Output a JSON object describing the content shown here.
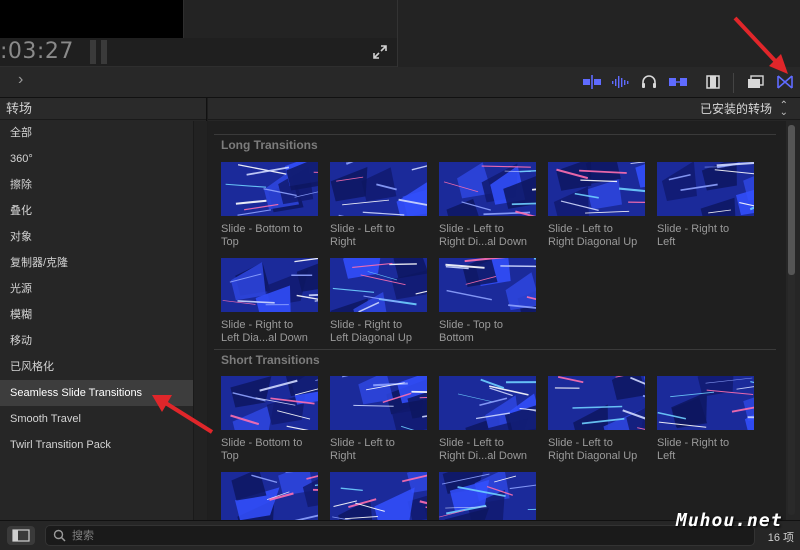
{
  "timecode": ":03:27",
  "toolbar": {
    "icons": [
      "clip-blade-icon",
      "audio-waveform-icon",
      "headphones-icon",
      "snapping-icon",
      "video-clips-icon",
      "photos-icon",
      "transitions-browser-icon"
    ],
    "accent": "#5f6bff"
  },
  "sidebar": {
    "title": "转场",
    "items": [
      {
        "label": "全部"
      },
      {
        "label": "360°"
      },
      {
        "label": "擦除"
      },
      {
        "label": "叠化"
      },
      {
        "label": "对象"
      },
      {
        "label": "复制器/克隆"
      },
      {
        "label": "光源"
      },
      {
        "label": "模糊"
      },
      {
        "label": "移动"
      },
      {
        "label": "已风格化"
      },
      {
        "label": "Seamless Slide Transitions"
      },
      {
        "label": "Smooth Travel"
      },
      {
        "label": "Twirl Transition Pack"
      }
    ],
    "selected_index": 10
  },
  "browser": {
    "filter_label": "已安装的转场",
    "sections": [
      {
        "title": "Long Transitions",
        "items": [
          {
            "line1": "Slide - Bottom to",
            "line2": "Top"
          },
          {
            "line1": "Slide - Left to",
            "line2": "Right"
          },
          {
            "line1": "Slide - Left to",
            "line2": "Right Di...al Down"
          },
          {
            "line1": "Slide - Left to",
            "line2": "Right Diagonal Up"
          },
          {
            "line1": "Slide - Right to",
            "line2": "Left"
          },
          {
            "line1": "Slide - Right to",
            "line2": "Left Dia...al Down"
          },
          {
            "line1": "Slide - Right to",
            "line2": "Left Diagonal Up"
          },
          {
            "line1": "Slide - Top to",
            "line2": "Bottom"
          }
        ]
      },
      {
        "title": "Short Transitions",
        "items": [
          {
            "line1": "Slide - Bottom to",
            "line2": "Top"
          },
          {
            "line1": "Slide - Left to",
            "line2": "Right"
          },
          {
            "line1": "Slide - Left to",
            "line2": "Right Di...al Down"
          },
          {
            "line1": "Slide - Left to",
            "line2": "Right Diagonal Up"
          },
          {
            "line1": "Slide - Right to",
            "line2": "Left"
          },
          {
            "line1": "",
            "line2": ""
          },
          {
            "line1": "",
            "line2": ""
          },
          {
            "line1": "",
            "line2": ""
          }
        ]
      }
    ]
  },
  "search": {
    "placeholder": "搜索"
  },
  "item_count": "16 项",
  "watermark": "Muhou.net",
  "annotation_color": "#e0262a"
}
